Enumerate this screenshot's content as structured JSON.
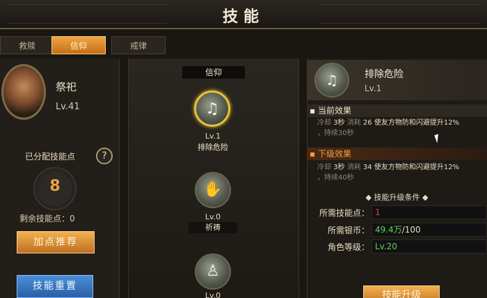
{
  "title": "技能",
  "tabs": [
    {
      "label": "救赎",
      "active": false
    },
    {
      "label": "信仰",
      "active": true
    },
    {
      "label": "戒律",
      "active": false
    }
  ],
  "character": {
    "name": "祭祀",
    "level": "Lv.41"
  },
  "points": {
    "allocated_label": "已分配技能点",
    "help_icon": "?",
    "allocated_value": "8",
    "remaining_label": "剩余技能点：0"
  },
  "buttons": {
    "recommend": "加点推荐",
    "reset": "技能重置",
    "upgrade": "技能升级"
  },
  "skill_column": {
    "header": "信仰",
    "skills": [
      {
        "level": "Lv.1",
        "name": "排除危险",
        "icon": "shield-hand-icon",
        "glyph": "♫",
        "selected": true
      },
      {
        "level": "Lv.0",
        "name": "祈祷",
        "icon": "praying-hands-icon",
        "glyph": "✋",
        "selected": false
      },
      {
        "level": "Lv.0",
        "name": "",
        "icon": "figure-icon",
        "glyph": "♙",
        "selected": false
      }
    ]
  },
  "detail": {
    "name": "排除危险",
    "level": "Lv.1",
    "icon": "shield-hand-icon",
    "current_title": "当前效果",
    "current_line1": [
      "冷却 ",
      "3秒",
      " 消耗 ",
      "26",
      " 使友方物防和闪避提升12%"
    ],
    "current_line2": "，持续30秒",
    "next_title": "下级效果",
    "next_line1": [
      "冷却 ",
      "3秒",
      " 消耗 ",
      "34",
      " 使友方物防和闪避提升12%"
    ],
    "next_line2": "，持续40秒",
    "upgrade_title": "技能升级条件",
    "requirements": [
      {
        "label": "所需技能点：",
        "value": "1"
      },
      {
        "label": "所需银币：",
        "value": "49.4万",
        "total": "/100"
      },
      {
        "label": "角色等级：",
        "value": "Lv.20"
      }
    ]
  },
  "colors": {
    "accent_orange": "#f0a040",
    "selected_ring": "#e6c23a",
    "reset_blue": "#2a5fa8",
    "requirement_red": "#e04040",
    "requirement_green": "#5ed060"
  }
}
